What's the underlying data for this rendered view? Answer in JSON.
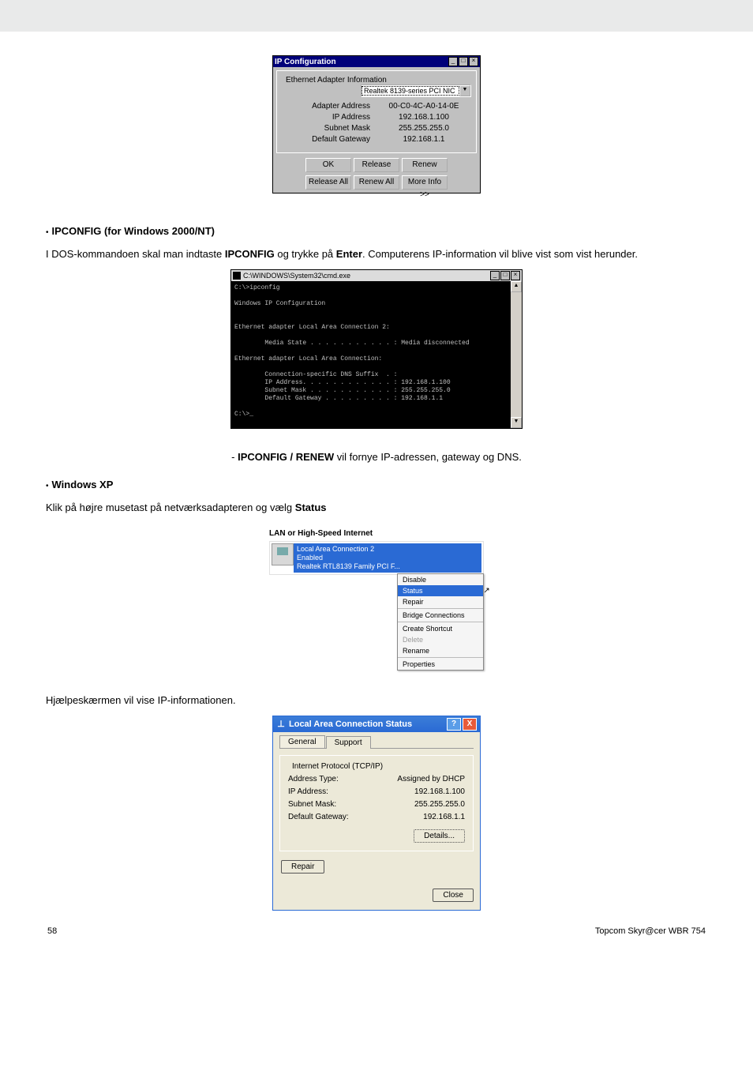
{
  "ipconfig_win": {
    "title": "IP Configuration",
    "fieldset_label": "Ethernet Adapter Information",
    "dropdown_value": "Realtek 8139-series PCI NIC",
    "rows": [
      {
        "label": "Adapter Address",
        "value": "00-C0-4C-A0-14-0E"
      },
      {
        "label": "IP Address",
        "value": "192.168.1.100"
      },
      {
        "label": "Subnet Mask",
        "value": "255.255.255.0"
      },
      {
        "label": "Default Gateway",
        "value": "192.168.1.1"
      }
    ],
    "buttons_row1": [
      "OK",
      "Release",
      "Renew"
    ],
    "buttons_row2": [
      "Release All",
      "Renew All",
      "More Info >>"
    ]
  },
  "section1_heading": "IPCONFIG (for Windows 2000/NT)",
  "section1_para_pre": "I DOS-kommandoen skal man indtaste ",
  "section1_para_bold1": "IPCONFIG",
  "section1_para_mid": " og trykke på ",
  "section1_para_bold2": "Enter",
  "section1_para_post": ". Computerens IP-information vil blive vist som vist herunder.",
  "cmd_win": {
    "title": "C:\\WINDOWS\\System32\\cmd.exe",
    "body": "C:\\>ipconfig\n\nWindows IP Configuration\n\n\nEthernet adapter Local Area Connection 2:\n\n        Media State . . . . . . . . . . . : Media disconnected\n\nEthernet adapter Local Area Connection:\n\n        Connection-specific DNS Suffix  . :\n        IP Address. . . . . . . . . . . . : 192.168.1.100\n        Subnet Mask . . . . . . . . . . . : 255.255.255.0\n        Default Gateway . . . . . . . . . : 192.168.1.1\n\nC:\\>_"
  },
  "renew_note_pre": "- ",
  "renew_note_bold": "IPCONFIG / RENEW",
  "renew_note_post": " vil fornye IP-adressen, gateway og DNS.",
  "section2_heading": "Windows XP",
  "section2_para_pre": "Klik på højre musetast på netværksadapteren og vælg ",
  "section2_para_bold": "Status",
  "lan_fig": {
    "header": "LAN or High-Speed Internet",
    "item_line1": "Local Area Connection 2",
    "item_line2": "Enabled",
    "item_line3": "Realtek RTL8139 Family PCI F...",
    "menu": {
      "disable": "Disable",
      "status": "Status",
      "repair": "Repair",
      "bridge": "Bridge Connections",
      "shortcut": "Create Shortcut",
      "delete": "Delete",
      "rename": "Rename",
      "properties": "Properties"
    }
  },
  "section3_para": "Hjælpeskærmen vil vise IP-informationen.",
  "status_win": {
    "title": "Local Area Connection Status",
    "tabs": {
      "general": "General",
      "support": "Support"
    },
    "fieldset": "Internet Protocol (TCP/IP)",
    "rows": [
      {
        "label": "Address Type:",
        "value": "Assigned by DHCP"
      },
      {
        "label": "IP Address:",
        "value": "192.168.1.100"
      },
      {
        "label": "Subnet Mask:",
        "value": "255.255.255.0"
      },
      {
        "label": "Default Gateway:",
        "value": "192.168.1.1"
      }
    ],
    "details_btn": "Details...",
    "repair_btn": "Repair",
    "close_btn": "Close"
  },
  "footer": {
    "page": "58",
    "product": "Topcom Skyr@cer WBR 754"
  }
}
